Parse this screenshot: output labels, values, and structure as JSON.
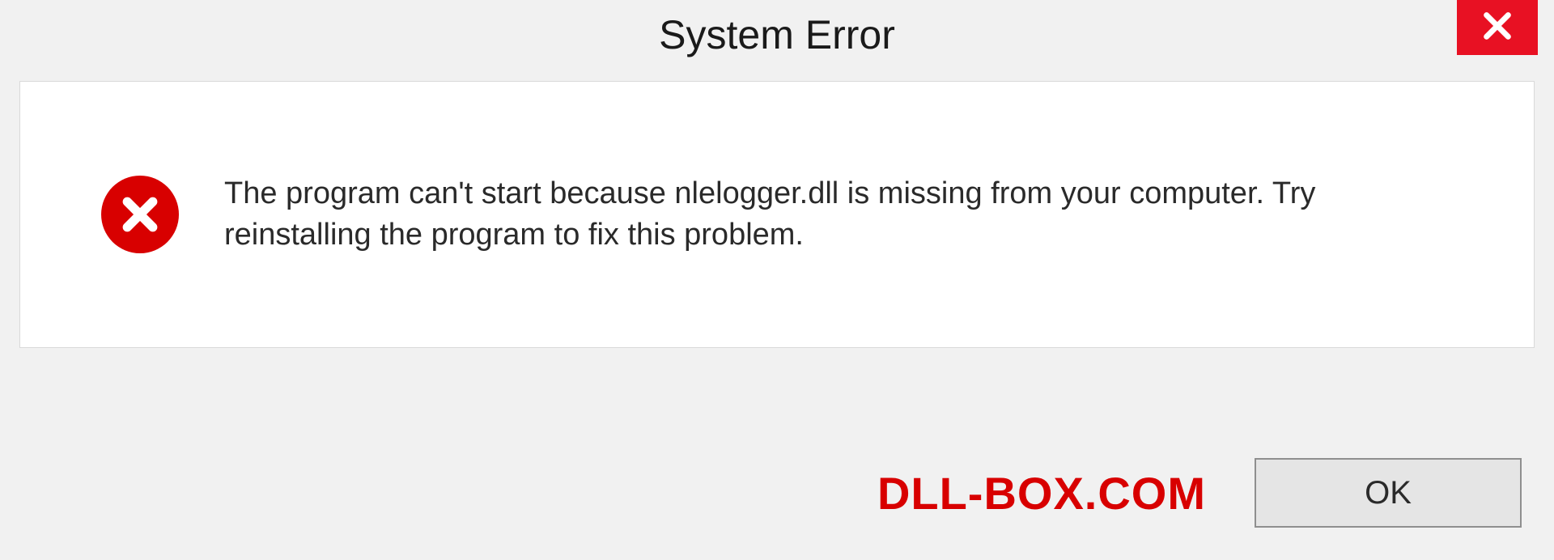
{
  "dialog": {
    "title": "System Error",
    "message": "The program can't start because nlelogger.dll is missing from your computer. Try reinstalling the program to fix this problem.",
    "ok_label": "OK"
  },
  "watermark": "DLL-BOX.COM",
  "colors": {
    "close_bg": "#e81123",
    "error_badge": "#d80000",
    "watermark": "#d80000"
  },
  "icons": {
    "close": "close-icon",
    "error": "error-circle-x-icon"
  }
}
